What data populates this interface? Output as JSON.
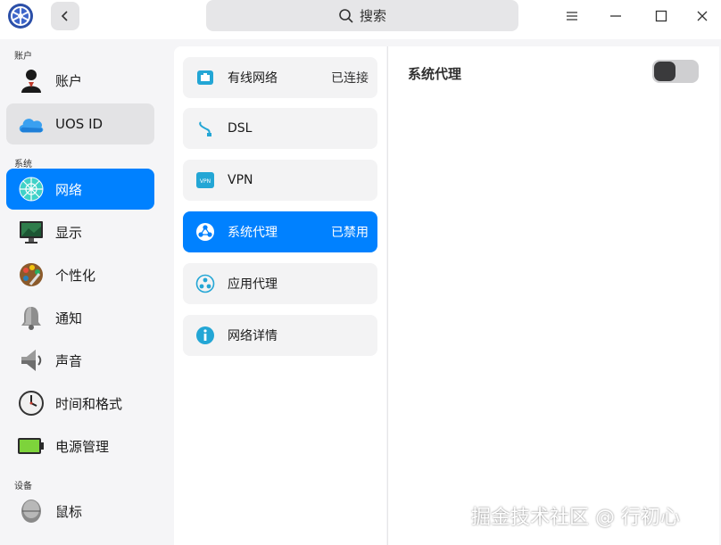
{
  "titlebar": {
    "search_label": "搜索",
    "icons": [
      "app-logo-icon",
      "back-icon",
      "search-icon",
      "menu-icon",
      "minimize-icon",
      "maximize-icon",
      "close-icon"
    ]
  },
  "sidebar": {
    "groups": [
      {
        "label": "账户"
      },
      {
        "label": "系统"
      },
      {
        "label": "设备"
      }
    ],
    "items": [
      {
        "label": "账户",
        "icon": "account-icon"
      },
      {
        "label": "UOS ID",
        "icon": "cloud-icon"
      },
      {
        "label": "网络",
        "icon": "network-icon"
      },
      {
        "label": "显示",
        "icon": "display-icon"
      },
      {
        "label": "个性化",
        "icon": "personalization-icon"
      },
      {
        "label": "通知",
        "icon": "bell-icon"
      },
      {
        "label": "声音",
        "icon": "speaker-icon"
      },
      {
        "label": "时间和格式",
        "icon": "clock-icon"
      },
      {
        "label": "电源管理",
        "icon": "battery-icon"
      },
      {
        "label": "鼠标",
        "icon": "mouse-icon"
      }
    ],
    "selected": "网络"
  },
  "network_menu": {
    "items": [
      {
        "label": "有线网络",
        "status": "已连接",
        "icon": "wired-network-icon"
      },
      {
        "label": "DSL",
        "status": "",
        "icon": "dsl-icon"
      },
      {
        "label": "VPN",
        "status": "",
        "icon": "vpn-icon"
      },
      {
        "label": "系统代理",
        "status": "已禁用",
        "icon": "system-proxy-icon"
      },
      {
        "label": "应用代理",
        "status": "",
        "icon": "app-proxy-icon"
      },
      {
        "label": "网络详情",
        "status": "",
        "icon": "info-icon"
      }
    ],
    "selected": "系统代理"
  },
  "detail": {
    "title": "系统代理",
    "toggle_on": false
  },
  "watermark": "掘金技术社区 @ 行初心",
  "colors": {
    "accent": "#0081ff",
    "window_bg": "#f5f5f7",
    "panel_bg": "#ffffff",
    "item_bg": "#f3f3f4"
  }
}
